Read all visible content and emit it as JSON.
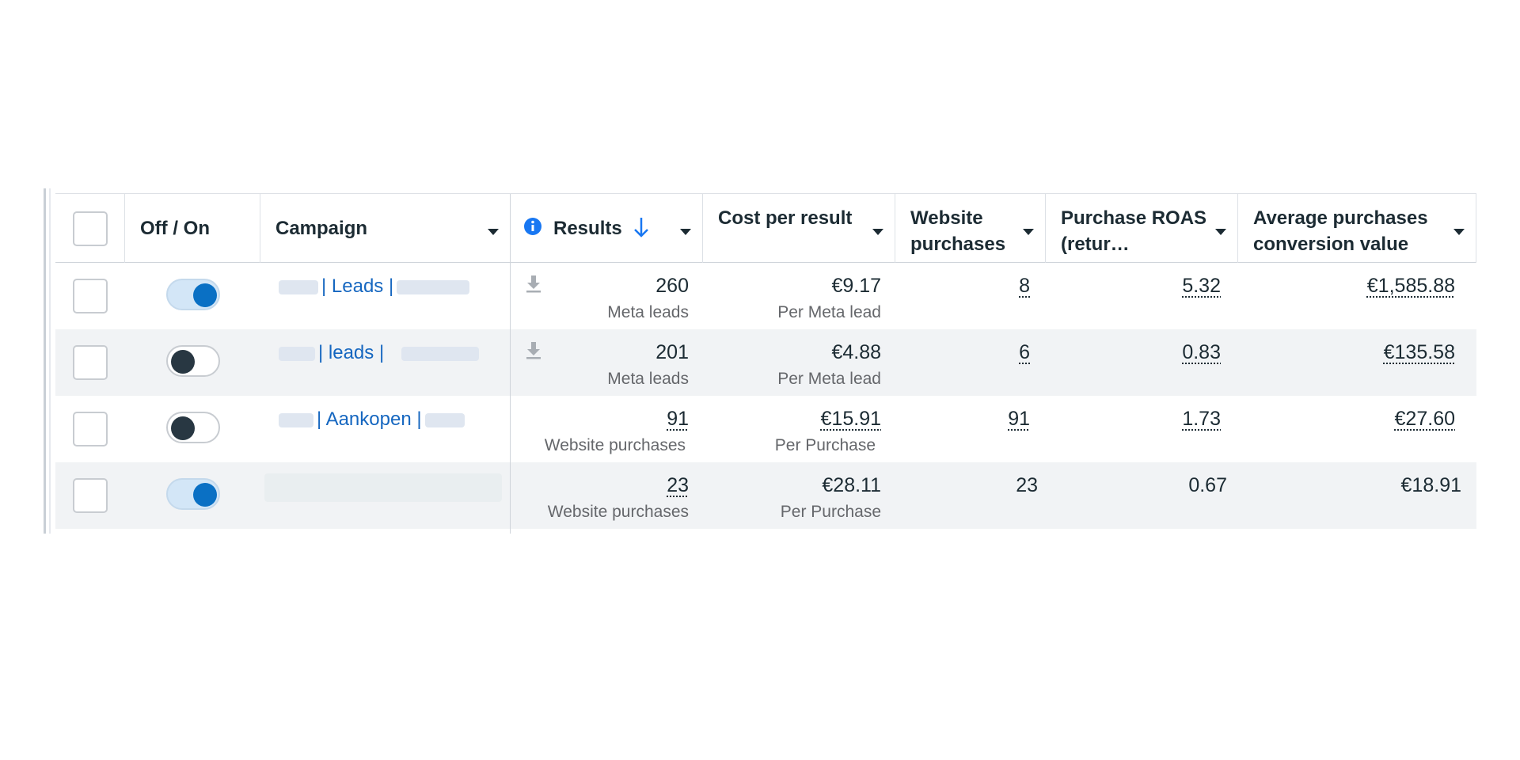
{
  "header": {
    "select_all_checkbox": "",
    "columns": [
      {
        "key": "off_on",
        "label": "Off / On"
      },
      {
        "key": "campaign",
        "label": "Campaign"
      },
      {
        "key": "results",
        "label": "Results"
      },
      {
        "key": "cost_per_result",
        "label": "Cost per result"
      },
      {
        "key": "website_purchases",
        "label": "Website purchases"
      },
      {
        "key": "purchase_roas",
        "label": "Purchase ROAS (retur…"
      },
      {
        "key": "avg_conversion_value",
        "label": "Average purchases conversion value"
      }
    ],
    "results_sort": "descending"
  },
  "rows": [
    {
      "toggle": "on",
      "campaign": "| Leads |",
      "results": "260",
      "results_type": "Meta leads",
      "cost": "€9.17",
      "cost_type": "Per Meta lead",
      "website_purchases": "8",
      "roas": "5.32",
      "avg_value": "€1,585.88"
    },
    {
      "toggle": "off",
      "campaign": "| leads |",
      "results": "201",
      "results_type": "Meta leads",
      "cost": "€4.88",
      "cost_type": "Per Meta lead",
      "website_purchases": "6",
      "roas": "0.83",
      "avg_value": "€135.58"
    },
    {
      "toggle": "off",
      "campaign": "| Aankopen |",
      "results": "91",
      "results_type": "Website purchases",
      "cost": "€15.91",
      "cost_type": "Per Purchase",
      "website_purchases": "91",
      "roas": "1.73",
      "avg_value": "€27.60"
    },
    {
      "toggle": "on",
      "campaign": "",
      "results": "23",
      "results_type": "Website purchases",
      "cost": "€28.11",
      "cost_type": "Per Purchase",
      "website_purchases": "23",
      "roas": "0.67",
      "avg_value": "€18.91"
    }
  ],
  "colors": {
    "link": "#1667c0",
    "toggle_on": "#0a70c4",
    "toggle_off_knob": "#283742",
    "info": "#1877f2"
  }
}
